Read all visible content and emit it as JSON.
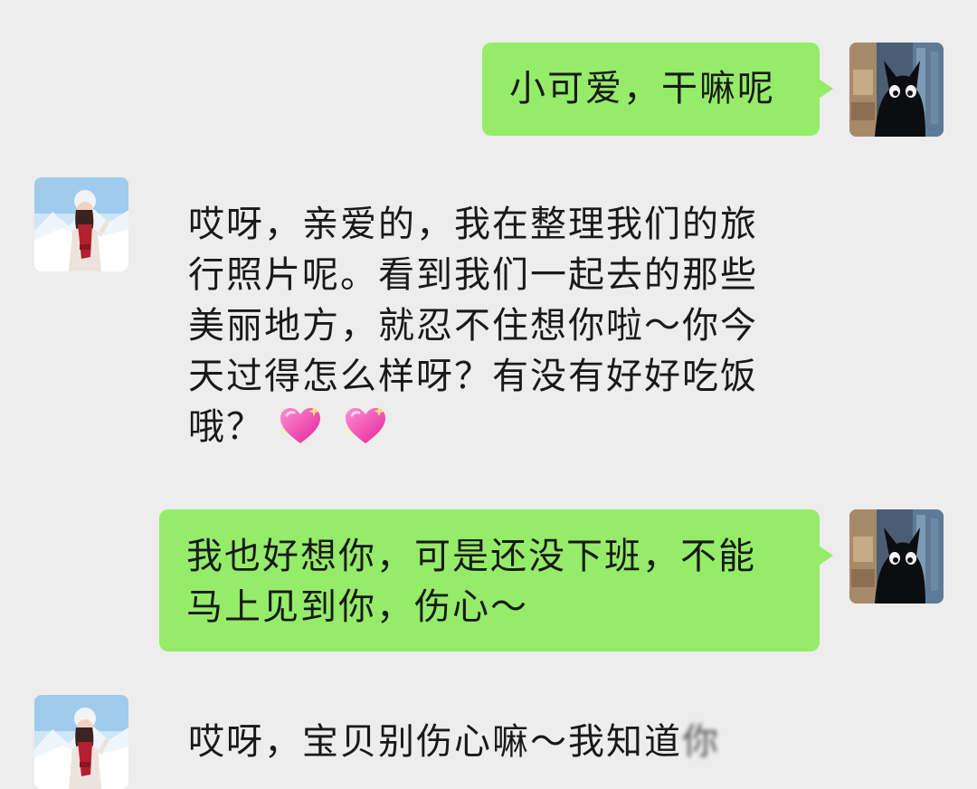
{
  "messages": [
    {
      "from": "me",
      "avatar_icon": "black-cat-avatar-icon",
      "text": "小可爱，干嘛呢"
    },
    {
      "from": "contact",
      "avatar_icon": "girl-snow-photo-avatar-icon",
      "text": "哎呀，亲爱的，我在整理我们的旅行照片呢。看到我们一起去的那些美丽地方，就忍不住想你啦～你今天过得怎么样呀？有没有好好吃饭哦？",
      "emoji": [
        "sparkling-heart-icon",
        "sparkling-heart-icon"
      ]
    },
    {
      "from": "me",
      "avatar_icon": "black-cat-avatar-icon",
      "text": "我也好想你，可是还没下班，不能马上见到你，伤心～"
    },
    {
      "from": "contact",
      "avatar_icon": "girl-snow-photo-avatar-icon",
      "text": "哎呀，宝贝别伤心嘛～我知道",
      "text_cut": "你"
    }
  ],
  "colors": {
    "background": "#ededed",
    "my_bubble": "#95ec69",
    "text": "#191919"
  }
}
